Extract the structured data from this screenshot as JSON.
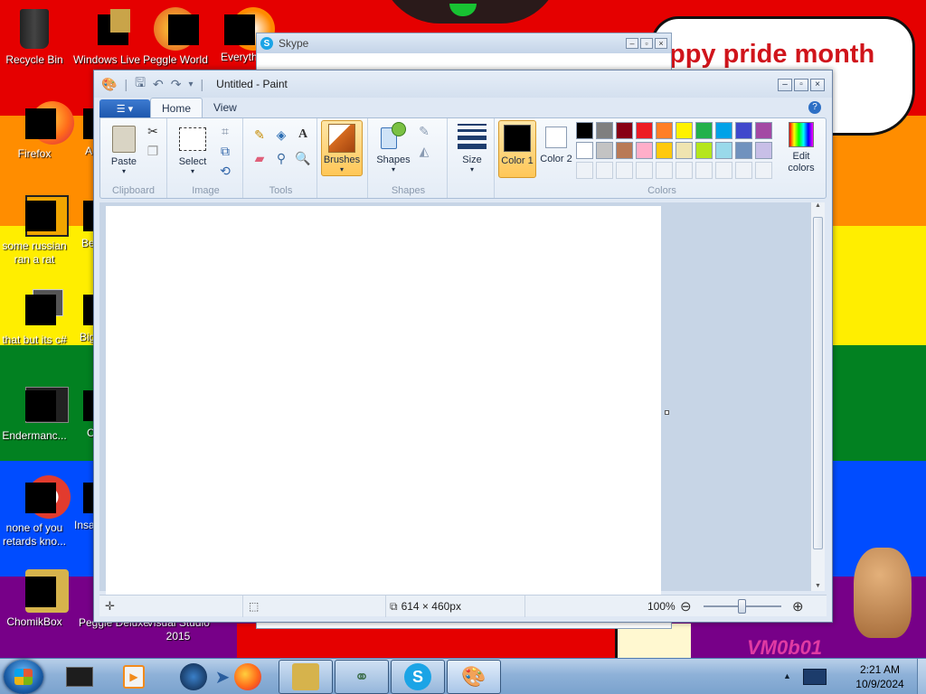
{
  "desktop": {
    "banner_text": "ppy pride month",
    "watermark": "VM0b01",
    "icons": [
      {
        "label": "Recycle Bin"
      },
      {
        "label": "Windows Live"
      },
      {
        "label": "Peggle World"
      },
      {
        "label": "Everyth"
      },
      {
        "label": "Firefox"
      },
      {
        "label": "A"
      },
      {
        "label": "some russian ran a rat"
      },
      {
        "label": "Be"
      },
      {
        "label": "that but its c#"
      },
      {
        "label": "Big"
      },
      {
        "label": "Endermanc..."
      },
      {
        "label": "C"
      },
      {
        "label": "none of you retards kno..."
      },
      {
        "label": "Insa"
      },
      {
        "label": "ChomikBox"
      },
      {
        "label": "Peggle Deluxe"
      },
      {
        "label": "Visual Studio 2015"
      }
    ],
    "colors": {
      "red": "#e50000",
      "orange": "#ff8d00",
      "yellow": "#ffee00",
      "green": "#028121",
      "blue": "#004cff",
      "purple": "#770088"
    }
  },
  "skype_window": {
    "title": "Skype"
  },
  "paint": {
    "title": "Untitled - Paint",
    "tabs": [
      "Home",
      "View"
    ],
    "groups": {
      "clipboard": "Clipboard",
      "image": "Image",
      "tools": "Tools",
      "shapes": "Shapes",
      "colors": "Colors"
    },
    "buttons": {
      "paste": "Paste",
      "select": "Select",
      "brushes": "Brushes",
      "shapes": "Shapes",
      "size": "Size",
      "color1": "Color 1",
      "color2": "Color 2",
      "edit_colors": "Edit colors"
    },
    "palette_row1": [
      "#000000",
      "#7f7f7f",
      "#880015",
      "#ed1c24",
      "#ff7f27",
      "#fff200",
      "#22b14c",
      "#00a2e8",
      "#3f48cc",
      "#a349a4"
    ],
    "palette_row2": [
      "#ffffff",
      "#c3c3c3",
      "#b97a57",
      "#ffaec9",
      "#ffc90e",
      "#efe4b0",
      "#b5e61d",
      "#99d9ea",
      "#7092be",
      "#c8bfe7"
    ],
    "status": {
      "size": "614 × 460px",
      "zoom": "100%"
    }
  },
  "taskbar": {
    "time": "2:21 AM",
    "date": "10/9/2024"
  }
}
